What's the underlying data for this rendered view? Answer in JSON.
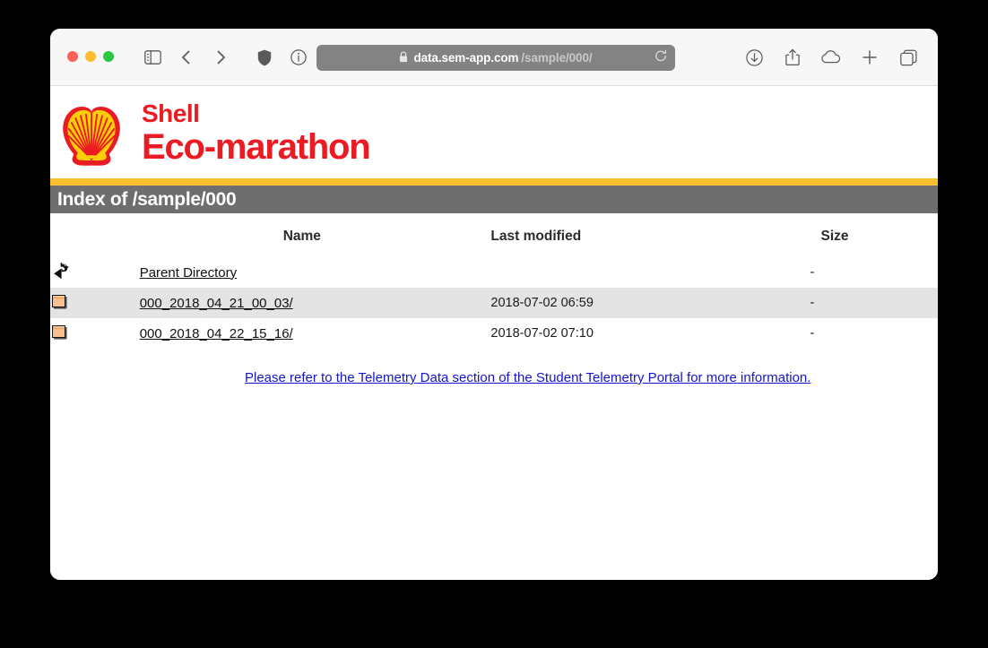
{
  "browser": {
    "traffic_lights": [
      "close",
      "minimize",
      "zoom"
    ],
    "address": {
      "host": "data.sem-app.com",
      "path": "/sample/000/",
      "secure_icon": "lock-icon",
      "reload_icon": "reload-icon"
    },
    "left_controls": [
      {
        "name": "sidebar-toggle-button",
        "icon": "sidebar-icon"
      },
      {
        "name": "back-button",
        "icon": "chevron-left-icon"
      },
      {
        "name": "forward-button",
        "icon": "chevron-right-icon"
      }
    ],
    "mid_controls": [
      {
        "name": "privacy-shield-button",
        "icon": "shield-icon"
      },
      {
        "name": "page-info-button",
        "icon": "info-circle-icon"
      }
    ],
    "right_controls": [
      {
        "name": "downloads-button",
        "icon": "download-icon"
      },
      {
        "name": "share-button",
        "icon": "share-icon"
      },
      {
        "name": "icloud-button",
        "icon": "cloud-icon"
      },
      {
        "name": "new-tab-button",
        "icon": "plus-icon"
      },
      {
        "name": "tab-overview-button",
        "icon": "tabs-icon"
      }
    ]
  },
  "brand": {
    "logo": "shell-pecten-logo",
    "line1": "Shell",
    "line2": "Eco-marathon",
    "color": "#ea1b22",
    "stripe_color": "#fbbe2e"
  },
  "index": {
    "title": "Index of /sample/000",
    "bar_color": "#6e6e6e"
  },
  "table": {
    "headers": {
      "name": "Name",
      "modified": "Last modified",
      "size": "Size"
    },
    "rows": [
      {
        "icon": "back-arrow-icon",
        "name": "Parent Directory",
        "modified": "",
        "size": "-",
        "highlighted": false
      },
      {
        "icon": "folder-icon",
        "name": "000_2018_04_21_00_03/",
        "modified": "2018-07-02 06:59",
        "size": "-",
        "highlighted": true
      },
      {
        "icon": "folder-icon",
        "name": "000_2018_04_22_15_16/",
        "modified": "2018-07-02 07:10",
        "size": "-",
        "highlighted": false
      }
    ]
  },
  "footer": {
    "link_text": "Please refer to the Telemetry Data section of the Student Telemetry Portal for more information.",
    "link_color": "#1414cc"
  }
}
